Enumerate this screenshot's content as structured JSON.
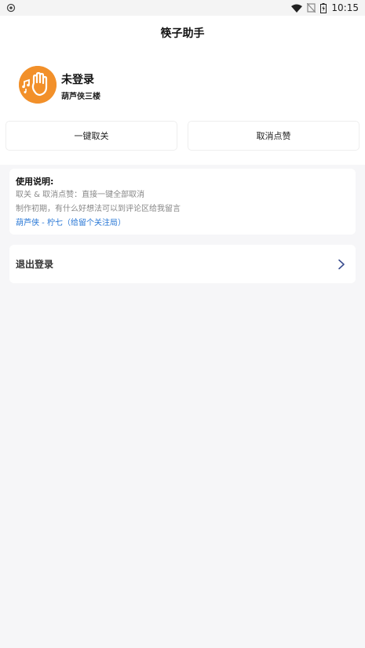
{
  "status_bar": {
    "time": "10:15",
    "icons": [
      "vpn-icon",
      "wifi-icon",
      "no-sim-icon",
      "battery-icon"
    ]
  },
  "app": {
    "title": "筷子助手"
  },
  "user": {
    "name": "未登录",
    "subtitle": "葫芦侠三楼",
    "avatar_color": "#f2902a"
  },
  "actions": {
    "unfollow_all": "一键取关",
    "cancel_likes": "取消点赞"
  },
  "instructions": {
    "title": "使用说明:",
    "line1": "取关 & 取消点赞：直接一键全部取消",
    "line2": "制作初期，有什么好想法可以到评论区给我留言",
    "link": "葫芦侠 - 柠七（给留个关注局）"
  },
  "logout": {
    "label": "退出登录"
  },
  "colors": {
    "background": "#f6f6f8",
    "card": "#ffffff",
    "link": "#2a78d6",
    "accent": "#f2902a"
  }
}
